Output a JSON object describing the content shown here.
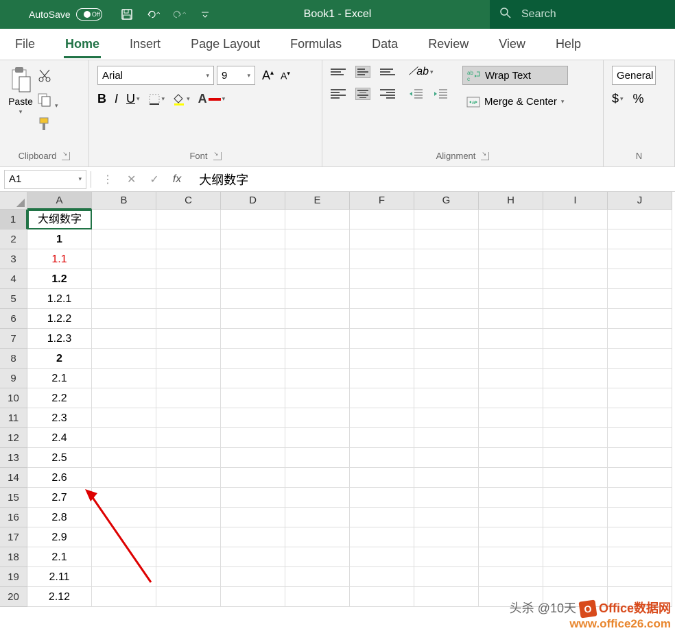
{
  "title_bar": {
    "autosave_label": "AutoSave",
    "autosave_state": "Off",
    "doc_title": "Book1  -  Excel",
    "search_placeholder": "Search"
  },
  "tabs": [
    "File",
    "Home",
    "Insert",
    "Page Layout",
    "Formulas",
    "Data",
    "Review",
    "View",
    "Help"
  ],
  "active_tab": "Home",
  "ribbon": {
    "clipboard": {
      "label": "Clipboard",
      "paste": "Paste"
    },
    "font": {
      "label": "Font",
      "name": "Arial",
      "size": "9",
      "bold": "B",
      "italic": "I",
      "underline": "U"
    },
    "alignment": {
      "label": "Alignment",
      "wrap": "Wrap Text",
      "merge": "Merge & Center"
    },
    "number": {
      "label": "N",
      "format": "General",
      "currency": "$"
    }
  },
  "formula_bar": {
    "name_box": "A1",
    "fx": "fx",
    "value": "大纲数字"
  },
  "columns": [
    "A",
    "B",
    "C",
    "D",
    "E",
    "F",
    "G",
    "H",
    "I",
    "J"
  ],
  "cells": [
    {
      "row": 1,
      "val": "大纲数字",
      "bold": false,
      "red": false
    },
    {
      "row": 2,
      "val": "1",
      "bold": true,
      "red": false
    },
    {
      "row": 3,
      "val": "1.1",
      "bold": false,
      "red": true
    },
    {
      "row": 4,
      "val": "1.2",
      "bold": true,
      "red": false
    },
    {
      "row": 5,
      "val": "1.2.1",
      "bold": false,
      "red": false
    },
    {
      "row": 6,
      "val": "1.2.2",
      "bold": false,
      "red": false
    },
    {
      "row": 7,
      "val": "1.2.3",
      "bold": false,
      "red": false
    },
    {
      "row": 8,
      "val": "2",
      "bold": true,
      "red": false
    },
    {
      "row": 9,
      "val": "2.1",
      "bold": false,
      "red": false
    },
    {
      "row": 10,
      "val": "2.2",
      "bold": false,
      "red": false
    },
    {
      "row": 11,
      "val": "2.3",
      "bold": false,
      "red": false
    },
    {
      "row": 12,
      "val": "2.4",
      "bold": false,
      "red": false
    },
    {
      "row": 13,
      "val": "2.5",
      "bold": false,
      "red": false
    },
    {
      "row": 14,
      "val": "2.6",
      "bold": false,
      "red": false
    },
    {
      "row": 15,
      "val": "2.7",
      "bold": false,
      "red": false
    },
    {
      "row": 16,
      "val": "2.8",
      "bold": false,
      "red": false
    },
    {
      "row": 17,
      "val": "2.9",
      "bold": false,
      "red": false
    },
    {
      "row": 18,
      "val": "2.1",
      "bold": false,
      "red": false
    },
    {
      "row": 19,
      "val": "2.11",
      "bold": false,
      "red": false
    },
    {
      "row": 20,
      "val": "2.12",
      "bold": false,
      "red": false
    }
  ],
  "active_cell": {
    "row": 1,
    "col": "A"
  },
  "watermark": {
    "line1": "头杀 @10天",
    "brand": "Office数据网",
    "url": "www.office26.com"
  }
}
